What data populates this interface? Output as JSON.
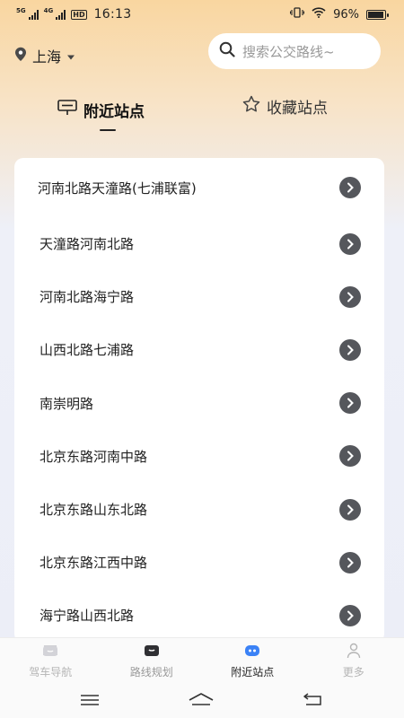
{
  "status_bar": {
    "network_1": "5G",
    "network_2": "4G",
    "hd": "HD",
    "time": "16:13",
    "battery": "96%"
  },
  "header": {
    "city": "上海",
    "search_placeholder": "搜索公交路线~"
  },
  "tabs": [
    {
      "label": "附近站点",
      "active": true
    },
    {
      "label": "收藏站点",
      "active": false
    }
  ],
  "stops": [
    "河南北路天潼路(七浦联富)",
    "天潼路河南北路",
    "河南北路海宁路",
    "山西北路七浦路",
    "南崇明路",
    "北京东路河南中路",
    "北京东路山东北路",
    "北京东路江西中路",
    "海宁路山西北路"
  ],
  "bottom_nav": [
    {
      "label": "驾车导航",
      "icon": "car-nav-icon"
    },
    {
      "label": "路线规划",
      "icon": "route-plan-icon"
    },
    {
      "label": "附近站点",
      "icon": "nearby-stop-icon",
      "active": true
    },
    {
      "label": "更多",
      "icon": "more-user-icon"
    }
  ],
  "colors": {
    "active_nav": "#3b82f6",
    "arrow_bg": "#55575c",
    "header_gradient_top": "#f9d6a0"
  }
}
